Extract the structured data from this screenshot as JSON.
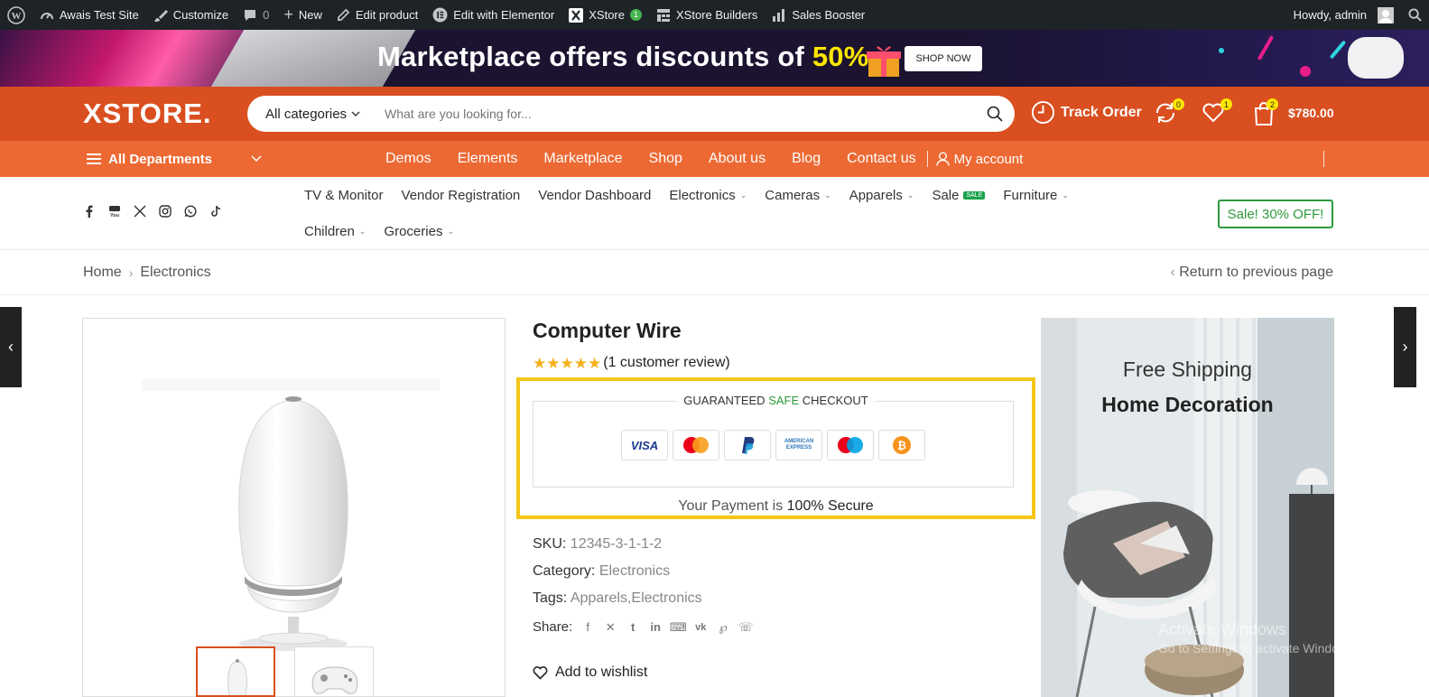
{
  "admin_bar": {
    "site_name": "Awais Test Site",
    "customize": "Customize",
    "comments_count": "0",
    "new": "New",
    "edit_product": "Edit product",
    "edit_elementor": "Edit with Elementor",
    "xstore": "XStore",
    "xstore_badge": "1",
    "xstore_builders": "XStore Builders",
    "sales_booster": "Sales Booster",
    "howdy": "Howdy, admin"
  },
  "promo": {
    "text": "Marketplace offers discounts of ",
    "highlight": "50%",
    "button": "SHOP NOW"
  },
  "header": {
    "logo": "XSTORE.",
    "search_category": "All categories",
    "search_placeholder": "What are you looking for...",
    "track_order": "Track Order",
    "compare_count": "0",
    "wishlist_count": "1",
    "cart_count": "2",
    "cart_total": "$780.00"
  },
  "nav": {
    "all_departments": "All Departments",
    "items": [
      "Demos",
      "Elements",
      "Marketplace",
      "Shop",
      "About us",
      "Blog",
      "Contact us"
    ],
    "my_account": "My account"
  },
  "submenu": {
    "row1": [
      {
        "label": "TV & Monitor",
        "chevron": false
      },
      {
        "label": "Vendor Registration",
        "chevron": false
      },
      {
        "label": "Vendor Dashboard",
        "chevron": false
      },
      {
        "label": "Electronics",
        "chevron": true
      },
      {
        "label": "Cameras",
        "chevron": true
      },
      {
        "label": "Apparels",
        "chevron": true
      },
      {
        "label": "Sale",
        "chevron": false,
        "badge": "SALE"
      },
      {
        "label": "Furniture",
        "chevron": true
      }
    ],
    "row2": [
      {
        "label": "Children",
        "chevron": true
      },
      {
        "label": "Groceries",
        "chevron": true
      }
    ],
    "sale_button": "Sale! 30% OFF!"
  },
  "breadcrumb": {
    "home": "Home",
    "current": "Electronics",
    "return": "Return to previous page"
  },
  "product": {
    "title": "Computer Wire",
    "rating_stars": 5,
    "reviews": "(1 customer review)",
    "sku_label": "SKU:",
    "sku": "12345-3-1-1-2",
    "category_label": "Category:",
    "category": "Electronics",
    "tags_label": "Tags:",
    "tags": "Apparels,Electronics",
    "share_label": "Share:",
    "wishlist": "Add to wishlist"
  },
  "checkout": {
    "label_pre": "GUARANTEED ",
    "label_safe": "SAFE",
    "label_post": " CHECKOUT",
    "cards": [
      "visa",
      "mastercard",
      "paypal",
      "amex",
      "maestro",
      "bitcoin"
    ],
    "visa_text": "VISA",
    "amex_text": "AMERICAN EXPRESS",
    "secure_pre": "Your Payment is ",
    "secure_strong": "100% Secure"
  },
  "banner": {
    "line1": "Free Shipping",
    "line2": "Home Decoration"
  },
  "watermark": {
    "line1": "Activate Windows",
    "line2": "Go to Settings to activate Windows."
  },
  "colors": {
    "header": "#d94f20",
    "nav": "#ed6933",
    "accent_yellow": "#ffe600",
    "green": "#2e9a3d",
    "highlight_frame": "#f5c518"
  }
}
